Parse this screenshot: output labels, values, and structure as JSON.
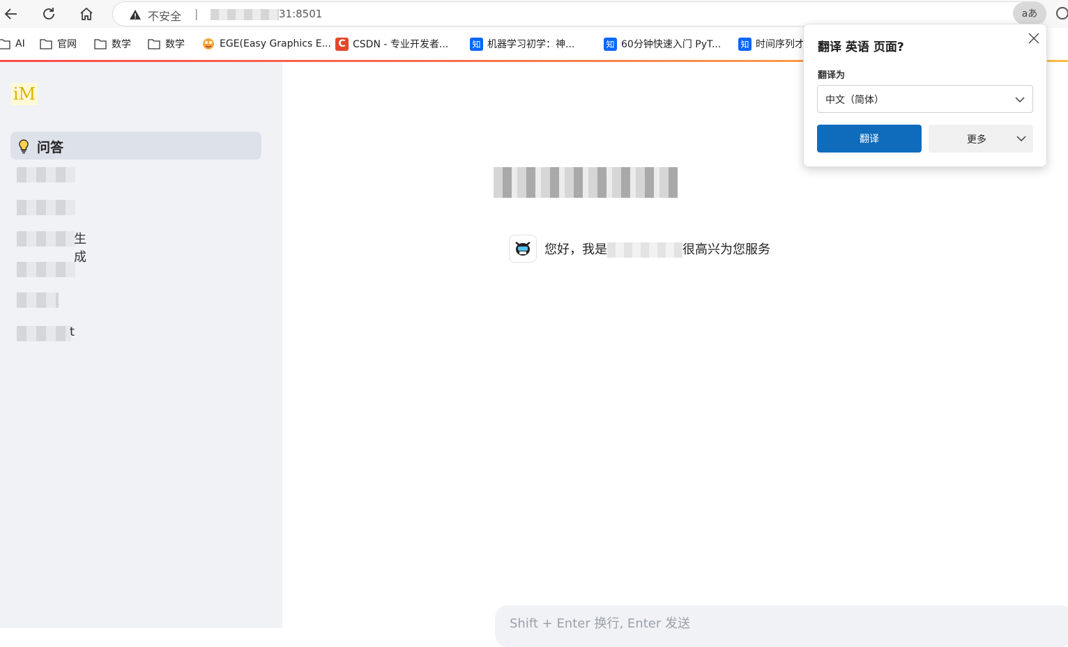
{
  "browser": {
    "insecure_label": "不安全",
    "separator": "|",
    "url": "31:8501",
    "translate_icon_label": "aあ"
  },
  "bookmarks": [
    {
      "label": "AI",
      "icon": "folder-icon"
    },
    {
      "label": "官网",
      "icon": "folder-icon"
    },
    {
      "label": "数学",
      "icon": "folder-icon"
    },
    {
      "label": "数学",
      "icon": "folder-icon"
    },
    {
      "label": "EGE(Easy Graphics E...",
      "icon": "ege-favicon"
    },
    {
      "label": "CSDN - 专业开发者...",
      "icon": "csdn-favicon"
    },
    {
      "label": "机器学习初学：神...",
      "icon": "zhihu-favicon"
    },
    {
      "label": "60分钟快速入门 PyT...",
      "icon": "zhihu-favicon"
    },
    {
      "label": "时间序列才",
      "icon": "zhihu-favicon"
    }
  ],
  "icons": {
    "zhihu": "知",
    "csdn": "C"
  },
  "sidebar": {
    "logo_text": "iM",
    "active_item": "问答",
    "items": [
      {
        "suffix": ""
      },
      {
        "suffix": ""
      },
      {
        "suffix": "生成"
      },
      {
        "suffix": ""
      },
      {
        "suffix": ""
      },
      {
        "suffix": "t"
      }
    ]
  },
  "main": {
    "greeting_prefix": "您好，我是",
    "greeting_suffix": "很高兴为您服务",
    "input_placeholder": "Shift + Enter 换行, Enter 发送"
  },
  "translate_popup": {
    "title": "翻译 英语 页面?",
    "target_label": "翻译为",
    "target_language": "中文（简体）",
    "translate_button": "翻译",
    "more_button": "更多"
  },
  "colors": {
    "accent_blue": "#0f6cbd",
    "sidebar_bg": "#f0f2f6",
    "streamlit_red": "#ff4b4b"
  }
}
